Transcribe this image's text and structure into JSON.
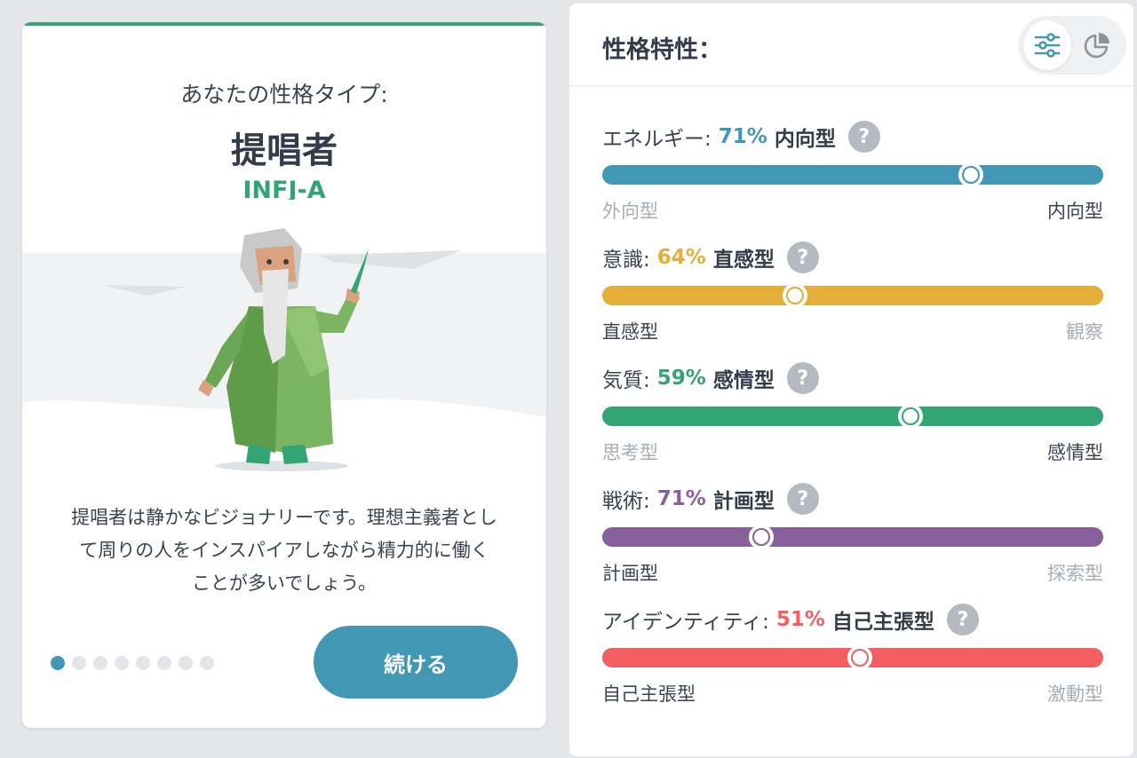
{
  "colors": {
    "accent_green": "#33a474",
    "accent_blue": "#4298b4",
    "top_bar": "#33a474"
  },
  "type_card": {
    "intro": "あなたの性格タイプ:",
    "name": "提唱者",
    "code": "INFJ-A",
    "description": "提唱者は静かなビジョナリーです。理想主義者として周りの人をインスパイアしながら精力的に働くことが多いでしょう。",
    "description_lines": [
      "提唱者は静かなビジョナリーです。理想主義者とし",
      "て周りの人をインスパイアしながら精力的に働く",
      "ことが多いでしょう。"
    ],
    "illustration_icon": "advocate-character-illustration",
    "pager": {
      "total": 8,
      "current": 1
    },
    "continue_label": "続ける"
  },
  "traits_panel": {
    "title": "性格特性：",
    "view_toggle": [
      {
        "icon": "sliders-icon",
        "active": true
      },
      {
        "icon": "pie-chart-icon",
        "active": false
      }
    ],
    "help_label": "?",
    "traits": [
      {
        "label": "エネルギー:",
        "percent": "71%",
        "result": "内向型",
        "color": "#4298b4",
        "position": 0.735,
        "left": "外向型",
        "right": "内向型",
        "highlight": "right"
      },
      {
        "label": "意識:",
        "percent": "64%",
        "result": "直感型",
        "color": "#e4ae3a",
        "position": 0.385,
        "left": "直感型",
        "right": "観察",
        "highlight": "left"
      },
      {
        "label": "気質:",
        "percent": "59%",
        "result": "感情型",
        "color": "#33a474",
        "position": 0.615,
        "left": "思考型",
        "right": "感情型",
        "highlight": "right"
      },
      {
        "label": "戦術:",
        "percent": "71%",
        "result": "計画型",
        "color": "#88619a",
        "position": 0.317,
        "left": "計画型",
        "right": "探索型",
        "highlight": "left"
      },
      {
        "label": "アイデンティティ:",
        "percent": "51%",
        "result": "自己主張型",
        "color": "#f25e62",
        "position": 0.515,
        "left": "自己主張型",
        "right": "激動型",
        "highlight": "left"
      }
    ]
  }
}
